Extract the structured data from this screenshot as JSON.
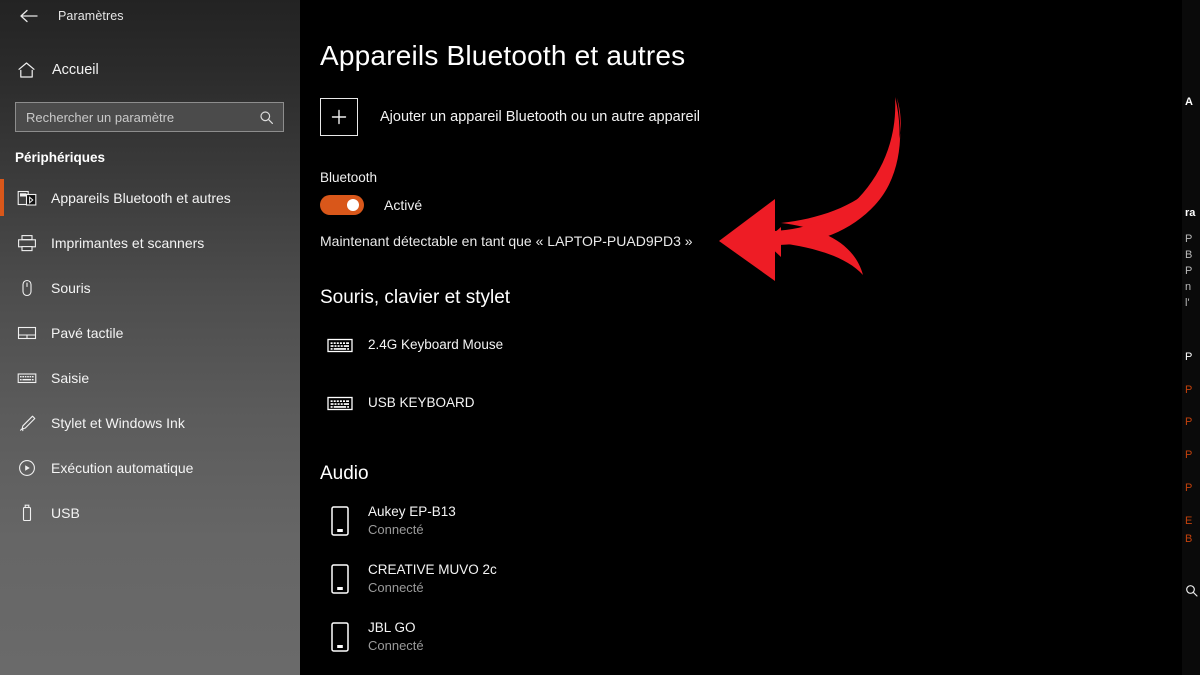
{
  "window": {
    "back_icon": "back-arrow-icon",
    "title": "Paramètres"
  },
  "sidebar": {
    "home": {
      "icon": "home-icon",
      "label": "Accueil"
    },
    "search": {
      "placeholder": "Rechercher un paramètre",
      "value": "",
      "icon": "search-icon"
    },
    "section_title": "Périphériques",
    "accent_color": "#d9571a",
    "items": [
      {
        "icon": "bluetooth-devices-icon",
        "label": "Appareils Bluetooth et autres",
        "selected": true
      },
      {
        "icon": "printer-icon",
        "label": "Imprimantes et scanners",
        "selected": false
      },
      {
        "icon": "mouse-icon",
        "label": "Souris",
        "selected": false
      },
      {
        "icon": "touchpad-icon",
        "label": "Pavé tactile",
        "selected": false
      },
      {
        "icon": "keyboard-icon",
        "label": "Saisie",
        "selected": false
      },
      {
        "icon": "pen-icon",
        "label": "Stylet et Windows Ink",
        "selected": false
      },
      {
        "icon": "autoplay-icon",
        "label": "Exécution automatique",
        "selected": false
      },
      {
        "icon": "usb-icon",
        "label": "USB",
        "selected": false
      }
    ]
  },
  "main": {
    "title": "Appareils Bluetooth et autres",
    "add_device": {
      "icon": "plus-icon",
      "label": "Ajouter un appareil Bluetooth ou un autre appareil"
    },
    "bluetooth": {
      "label": "Bluetooth",
      "toggle_state": "Activé",
      "toggle_on": true,
      "toggle_color": "#d9571a",
      "discoverable_text": "Maintenant détectable en tant que « LAPTOP-PUAD9PD3 »"
    },
    "groups": [
      {
        "title": "Souris, clavier et stylet",
        "devices": [
          {
            "icon": "keyboard-icon",
            "name": "2.4G Keyboard Mouse",
            "status": ""
          },
          {
            "icon": "keyboard-icon",
            "name": "USB KEYBOARD",
            "status": ""
          }
        ]
      },
      {
        "title": "Audio",
        "devices": [
          {
            "icon": "speaker-icon",
            "name": "Aukey EP-B13",
            "status": "Connecté"
          },
          {
            "icon": "speaker-icon",
            "name": "CREATIVE MUVO 2c",
            "status": "Connecté"
          },
          {
            "icon": "speaker-icon",
            "name": "JBL GO",
            "status": "Connecté"
          }
        ]
      }
    ]
  },
  "annotation": {
    "shape": "curved-arrow-pointing-left",
    "color": "#ee1c25"
  },
  "edge_panel": {
    "heading_lines": [
      "A",
      "ra"
    ],
    "paragraph_lines": [
      "P",
      "B",
      "P",
      "n",
      "l'"
    ],
    "link_lines": [
      "P",
      "P",
      "P",
      "P",
      "P",
      "E",
      "B"
    ],
    "search_icon": "search-icon",
    "link_color": "#c2410c"
  }
}
